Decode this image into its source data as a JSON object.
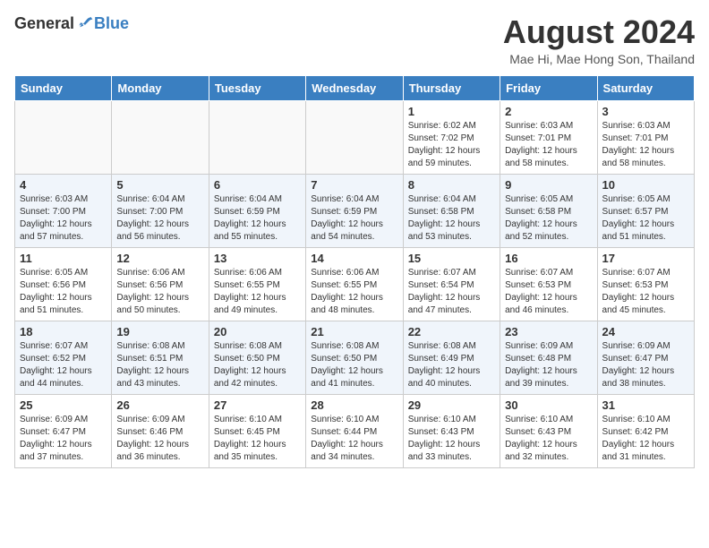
{
  "header": {
    "logo_general": "General",
    "logo_blue": "Blue",
    "month_title": "August 2024",
    "location": "Mae Hi, Mae Hong Son, Thailand"
  },
  "weekdays": [
    "Sunday",
    "Monday",
    "Tuesday",
    "Wednesday",
    "Thursday",
    "Friday",
    "Saturday"
  ],
  "weeks": [
    [
      {
        "day": "",
        "info": ""
      },
      {
        "day": "",
        "info": ""
      },
      {
        "day": "",
        "info": ""
      },
      {
        "day": "",
        "info": ""
      },
      {
        "day": "1",
        "info": "Sunrise: 6:02 AM\nSunset: 7:02 PM\nDaylight: 12 hours\nand 59 minutes."
      },
      {
        "day": "2",
        "info": "Sunrise: 6:03 AM\nSunset: 7:01 PM\nDaylight: 12 hours\nand 58 minutes."
      },
      {
        "day": "3",
        "info": "Sunrise: 6:03 AM\nSunset: 7:01 PM\nDaylight: 12 hours\nand 58 minutes."
      }
    ],
    [
      {
        "day": "4",
        "info": "Sunrise: 6:03 AM\nSunset: 7:00 PM\nDaylight: 12 hours\nand 57 minutes."
      },
      {
        "day": "5",
        "info": "Sunrise: 6:04 AM\nSunset: 7:00 PM\nDaylight: 12 hours\nand 56 minutes."
      },
      {
        "day": "6",
        "info": "Sunrise: 6:04 AM\nSunset: 6:59 PM\nDaylight: 12 hours\nand 55 minutes."
      },
      {
        "day": "7",
        "info": "Sunrise: 6:04 AM\nSunset: 6:59 PM\nDaylight: 12 hours\nand 54 minutes."
      },
      {
        "day": "8",
        "info": "Sunrise: 6:04 AM\nSunset: 6:58 PM\nDaylight: 12 hours\nand 53 minutes."
      },
      {
        "day": "9",
        "info": "Sunrise: 6:05 AM\nSunset: 6:58 PM\nDaylight: 12 hours\nand 52 minutes."
      },
      {
        "day": "10",
        "info": "Sunrise: 6:05 AM\nSunset: 6:57 PM\nDaylight: 12 hours\nand 51 minutes."
      }
    ],
    [
      {
        "day": "11",
        "info": "Sunrise: 6:05 AM\nSunset: 6:56 PM\nDaylight: 12 hours\nand 51 minutes."
      },
      {
        "day": "12",
        "info": "Sunrise: 6:06 AM\nSunset: 6:56 PM\nDaylight: 12 hours\nand 50 minutes."
      },
      {
        "day": "13",
        "info": "Sunrise: 6:06 AM\nSunset: 6:55 PM\nDaylight: 12 hours\nand 49 minutes."
      },
      {
        "day": "14",
        "info": "Sunrise: 6:06 AM\nSunset: 6:55 PM\nDaylight: 12 hours\nand 48 minutes."
      },
      {
        "day": "15",
        "info": "Sunrise: 6:07 AM\nSunset: 6:54 PM\nDaylight: 12 hours\nand 47 minutes."
      },
      {
        "day": "16",
        "info": "Sunrise: 6:07 AM\nSunset: 6:53 PM\nDaylight: 12 hours\nand 46 minutes."
      },
      {
        "day": "17",
        "info": "Sunrise: 6:07 AM\nSunset: 6:53 PM\nDaylight: 12 hours\nand 45 minutes."
      }
    ],
    [
      {
        "day": "18",
        "info": "Sunrise: 6:07 AM\nSunset: 6:52 PM\nDaylight: 12 hours\nand 44 minutes."
      },
      {
        "day": "19",
        "info": "Sunrise: 6:08 AM\nSunset: 6:51 PM\nDaylight: 12 hours\nand 43 minutes."
      },
      {
        "day": "20",
        "info": "Sunrise: 6:08 AM\nSunset: 6:50 PM\nDaylight: 12 hours\nand 42 minutes."
      },
      {
        "day": "21",
        "info": "Sunrise: 6:08 AM\nSunset: 6:50 PM\nDaylight: 12 hours\nand 41 minutes."
      },
      {
        "day": "22",
        "info": "Sunrise: 6:08 AM\nSunset: 6:49 PM\nDaylight: 12 hours\nand 40 minutes."
      },
      {
        "day": "23",
        "info": "Sunrise: 6:09 AM\nSunset: 6:48 PM\nDaylight: 12 hours\nand 39 minutes."
      },
      {
        "day": "24",
        "info": "Sunrise: 6:09 AM\nSunset: 6:47 PM\nDaylight: 12 hours\nand 38 minutes."
      }
    ],
    [
      {
        "day": "25",
        "info": "Sunrise: 6:09 AM\nSunset: 6:47 PM\nDaylight: 12 hours\nand 37 minutes."
      },
      {
        "day": "26",
        "info": "Sunrise: 6:09 AM\nSunset: 6:46 PM\nDaylight: 12 hours\nand 36 minutes."
      },
      {
        "day": "27",
        "info": "Sunrise: 6:10 AM\nSunset: 6:45 PM\nDaylight: 12 hours\nand 35 minutes."
      },
      {
        "day": "28",
        "info": "Sunrise: 6:10 AM\nSunset: 6:44 PM\nDaylight: 12 hours\nand 34 minutes."
      },
      {
        "day": "29",
        "info": "Sunrise: 6:10 AM\nSunset: 6:43 PM\nDaylight: 12 hours\nand 33 minutes."
      },
      {
        "day": "30",
        "info": "Sunrise: 6:10 AM\nSunset: 6:43 PM\nDaylight: 12 hours\nand 32 minutes."
      },
      {
        "day": "31",
        "info": "Sunrise: 6:10 AM\nSunset: 6:42 PM\nDaylight: 12 hours\nand 31 minutes."
      }
    ]
  ]
}
